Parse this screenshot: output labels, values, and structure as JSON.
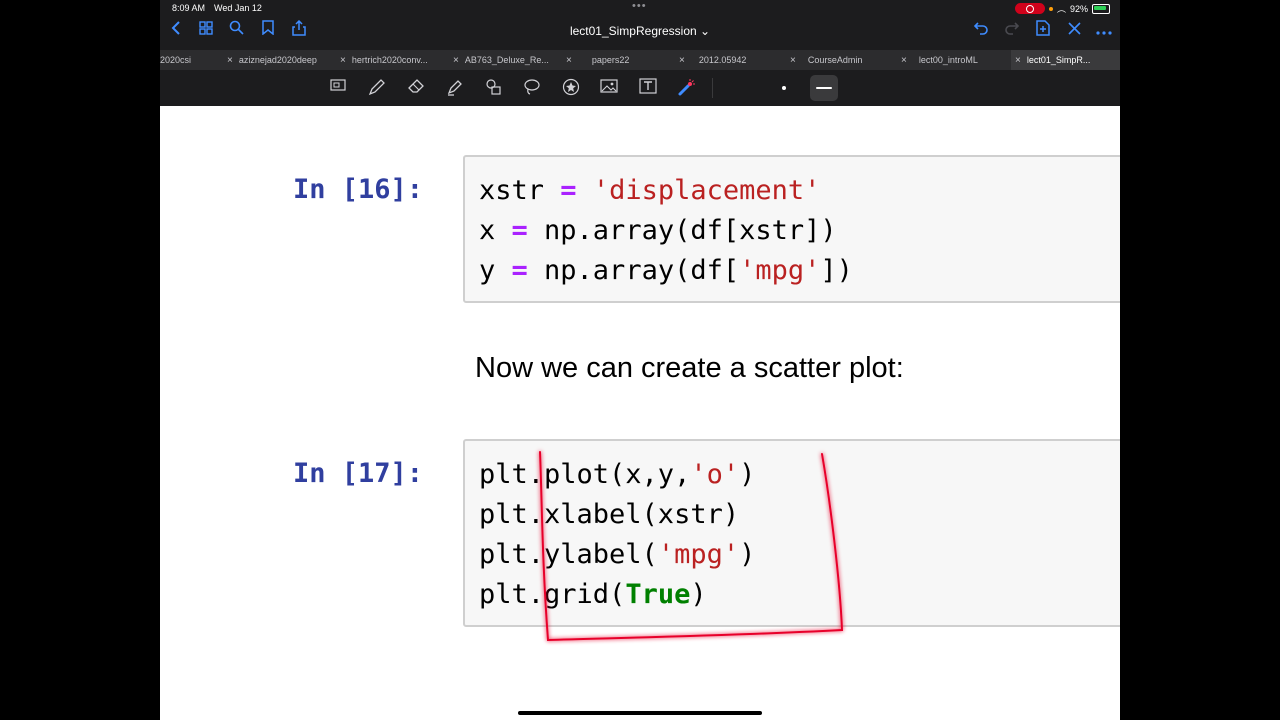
{
  "status": {
    "time": "8:09 AM",
    "date": "Wed Jan 12",
    "dots": "•••",
    "battery": "92%"
  },
  "nav": {
    "title": "lect01_SimpRegression ⌄",
    "accent": "#3f8cff"
  },
  "tabs": [
    {
      "label": "2020csi"
    },
    {
      "label": "aziznejad2020deep"
    },
    {
      "label": "hertrich2020conv..."
    },
    {
      "label": "AB763_Deluxe_Re..."
    },
    {
      "label": "papers22"
    },
    {
      "label": "2012.05942"
    },
    {
      "label": "CourseAdmin"
    },
    {
      "label": "lect00_introML"
    },
    {
      "label": "lect01_SimpR..."
    }
  ],
  "toolbar": {
    "icons": [
      "scan-icon",
      "pen-icon",
      "eraser-icon",
      "highlighter-icon",
      "shapes-icon",
      "lasso-icon",
      "sticker-icon",
      "image-icon",
      "textbox-icon",
      "laser-pointer-icon"
    ]
  },
  "cells": [
    {
      "prompt": "In [16]:",
      "lines": [
        [
          {
            "t": "xstr ",
            "c": ""
          },
          {
            "t": "=",
            "c": "op"
          },
          {
            "t": " ",
            "c": ""
          },
          {
            "t": "'displacement'",
            "c": "str"
          }
        ],
        [
          {
            "t": "x ",
            "c": ""
          },
          {
            "t": "=",
            "c": "op"
          },
          {
            "t": " np.array(df[xstr])",
            "c": ""
          }
        ],
        [
          {
            "t": "y ",
            "c": ""
          },
          {
            "t": "=",
            "c": "op"
          },
          {
            "t": " np.array(df[",
            "c": ""
          },
          {
            "t": "'mpg'",
            "c": "str"
          },
          {
            "t": "])",
            "c": ""
          }
        ]
      ]
    },
    {
      "prompt": "In [17]:",
      "lines": [
        [
          {
            "t": "plt.plot(x,y,",
            "c": ""
          },
          {
            "t": "'o'",
            "c": "str"
          },
          {
            "t": ")",
            "c": ""
          }
        ],
        [
          {
            "t": "plt.xlabel(xstr)",
            "c": ""
          }
        ],
        [
          {
            "t": "plt.ylabel(",
            "c": ""
          },
          {
            "t": "'mpg'",
            "c": "str"
          },
          {
            "t": ")",
            "c": ""
          }
        ],
        [
          {
            "t": "plt.grid(",
            "c": ""
          },
          {
            "t": "True",
            "c": "kw"
          },
          {
            "t": ")",
            "c": ""
          }
        ]
      ]
    }
  ],
  "markdown": {
    "text": "Now we can create a scatter plot:"
  },
  "annotation": {
    "color": "#e8002a"
  }
}
